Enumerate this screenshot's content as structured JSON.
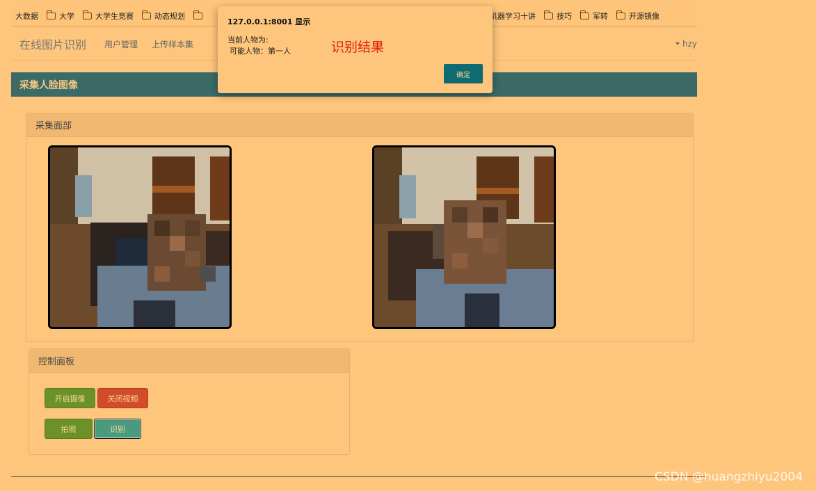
{
  "bookmarks": [
    {
      "label": "大数据",
      "folder": false
    },
    {
      "label": "大学",
      "folder": true
    },
    {
      "label": "大学生竞赛",
      "folder": true
    },
    {
      "label": "动态规划",
      "folder": true
    },
    {
      "label": "",
      "folder": true
    },
    {
      "label": "机器学习十讲",
      "folder": true
    },
    {
      "label": "技巧",
      "folder": true
    },
    {
      "label": "军转",
      "folder": true
    },
    {
      "label": "开源镜像",
      "folder": true
    }
  ],
  "navbar": {
    "brand": "在线图片识别",
    "links": [
      "用户管理",
      "上传样本集"
    ],
    "user": "hzy"
  },
  "section": {
    "title": "采集人脸图像"
  },
  "capture_panel": {
    "title": "采集面部"
  },
  "control_panel": {
    "title": "控制面板",
    "buttons": {
      "open_camera": "开启摄像",
      "close_video": "关闭视频",
      "photo": "拍照",
      "recognize": "识别"
    }
  },
  "dialog": {
    "title": "127.0.0.1:8001 显示",
    "line1": "当前人物为:",
    "line2": "可能人物：第一人",
    "annotation": "识别结果",
    "ok": "确定"
  },
  "watermark": "CSDN @huangzhiyu2004",
  "colors": {
    "page_bg": "#fec67c",
    "section_bar": "#3b6a67",
    "btn_green": "#6b9128",
    "btn_red": "#d24b2a",
    "btn_teal": "#4a9a80",
    "dialog_ok": "#0f6b72",
    "annotation_red": "#e02010"
  }
}
